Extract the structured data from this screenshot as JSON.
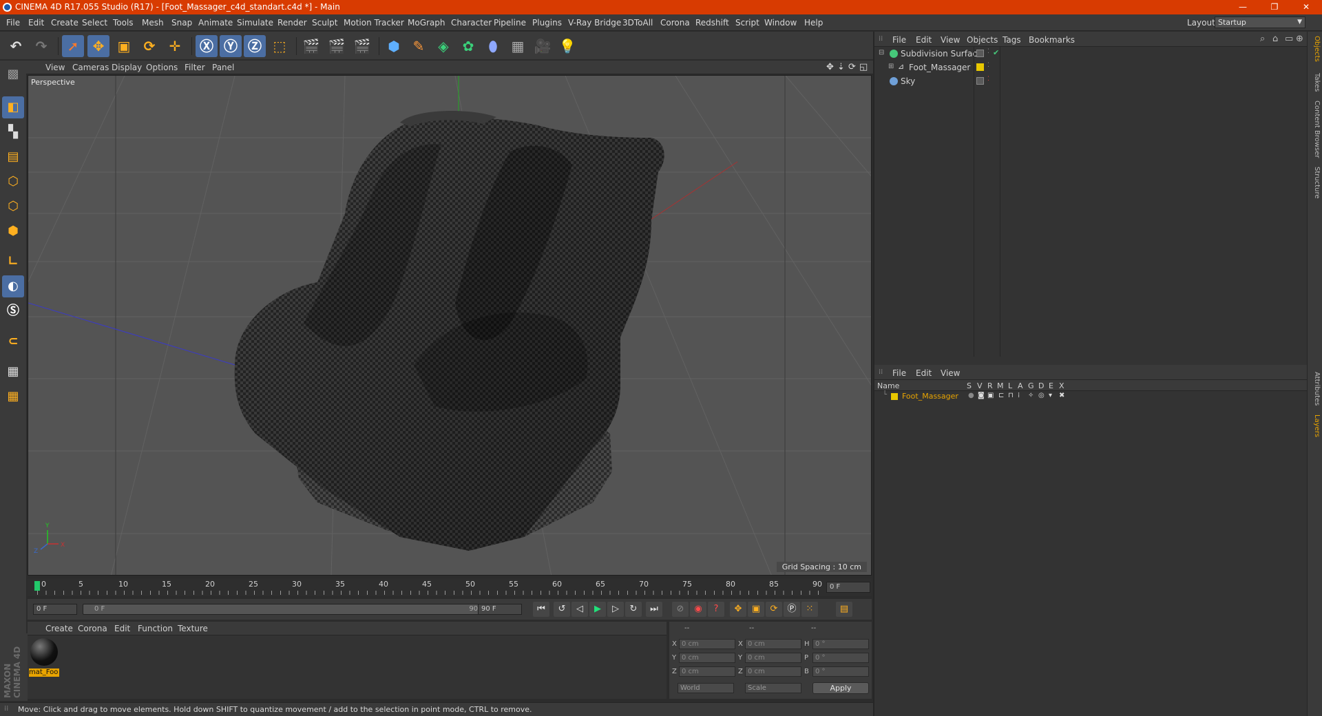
{
  "window": {
    "title": "CINEMA 4D R17.055 Studio (R17) - [Foot_Massager_c4d_standart.c4d *] - Main",
    "minimize": "—",
    "restore": "❐",
    "close": "✕"
  },
  "menubar": {
    "items": [
      "File",
      "Edit",
      "Create",
      "Select",
      "Tools",
      "Mesh",
      "Snap",
      "Animate",
      "Simulate",
      "Render",
      "Sculpt",
      "Motion Tracker",
      "MoGraph",
      "Character",
      "Pipeline",
      "Plugins",
      "V-Ray Bridge",
      "3DToAll",
      "Corona",
      "Redshift",
      "Script",
      "Window",
      "Help"
    ],
    "layout_label": "Layout:",
    "layout_value": "Startup"
  },
  "viewport": {
    "menu": [
      "View",
      "Cameras",
      "Display",
      "Options",
      "Filter",
      "Panel"
    ],
    "label": "Perspective",
    "grid_spacing": "Grid Spacing : 10 cm"
  },
  "timeline": {
    "ticks": [
      "0",
      "5",
      "10",
      "15",
      "20",
      "25",
      "30",
      "35",
      "40",
      "45",
      "50",
      "55",
      "60",
      "65",
      "70",
      "75",
      "80",
      "85",
      "90"
    ],
    "current_frame": "0 F",
    "start_field": "0 F",
    "range_start": "0 F",
    "range_end": "90 F",
    "end_field": "90 F"
  },
  "material_manager": {
    "menu": [
      "Create",
      "Corona",
      "Edit",
      "Function",
      "Texture"
    ],
    "material_name": "mat_Foo"
  },
  "coordinates": {
    "header": [
      "--",
      "--",
      "--"
    ],
    "rows": [
      {
        "label1": "X",
        "val1": "0 cm",
        "label2": "X",
        "val2": "0 cm",
        "label3": "H",
        "val3": "0 °"
      },
      {
        "label1": "Y",
        "val1": "0 cm",
        "label2": "Y",
        "val2": "0 cm",
        "label3": "P",
        "val3": "0 °"
      },
      {
        "label1": "Z",
        "val1": "0 cm",
        "label2": "Z",
        "val2": "0 cm",
        "label3": "B",
        "val3": "0 °"
      }
    ],
    "mode": "World",
    "scale": "Scale",
    "apply": "Apply"
  },
  "status": {
    "text": "Move: Click and drag to move elements. Hold down SHIFT to quantize movement / add to the selection in point mode, CTRL to remove."
  },
  "branding": {
    "logo": "MAXON CINEMA 4D"
  },
  "object_manager": {
    "menu": [
      "File",
      "Edit",
      "View",
      "Objects",
      "Tags",
      "Bookmarks"
    ],
    "objects": [
      {
        "name": "Subdivision Surface",
        "icon_color": "#46c87a"
      },
      {
        "name": "Foot_Massager",
        "icon_color": "#c8c8c8"
      },
      {
        "name": "Sky",
        "icon_color": "#6fa0d8"
      }
    ]
  },
  "layer_manager": {
    "menu": [
      "File",
      "Edit",
      "View"
    ],
    "columns": [
      "Name",
      "S",
      "V",
      "R",
      "M",
      "L",
      "A",
      "G",
      "D",
      "E",
      "X"
    ],
    "layers": [
      {
        "name": "Foot_Massager",
        "color": "#e8c800"
      }
    ]
  },
  "side_tabs": [
    "Objects",
    "Takes",
    "Content Browser",
    "Structure",
    "Attributes",
    "Layers"
  ],
  "colors": {
    "titlebar": "#d83b01",
    "accent_selection": "#4b6ea3",
    "highlight": "#e8a400"
  }
}
